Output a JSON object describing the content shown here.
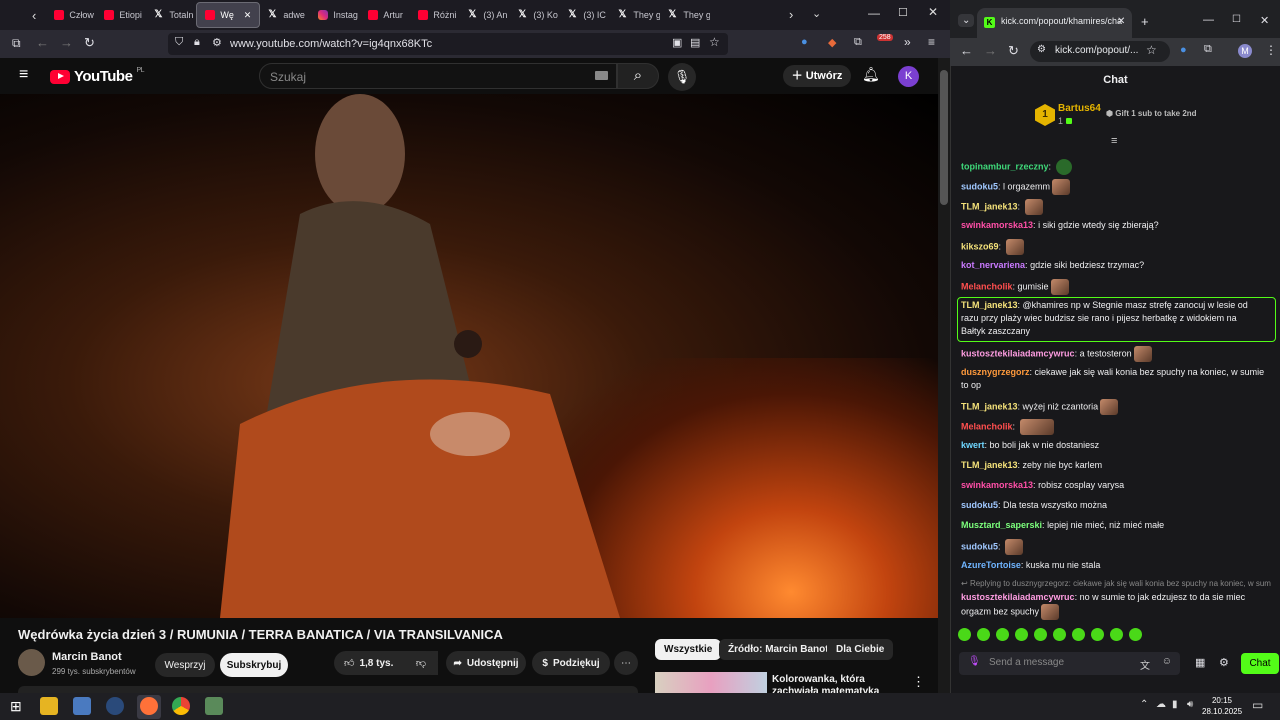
{
  "firefox": {
    "tabs": [
      {
        "label": "Człow",
        "icon": "youtube-icon"
      },
      {
        "label": "Etiopi",
        "icon": "youtube-icon"
      },
      {
        "label": "Totaln",
        "icon": "x-icon"
      },
      {
        "label": "Wę",
        "icon": "youtube-icon",
        "active": true
      },
      {
        "label": "adwe",
        "icon": "x-icon"
      },
      {
        "label": "Instag",
        "icon": "instagram-icon"
      },
      {
        "label": "Artur",
        "icon": "youtube-icon"
      },
      {
        "label": "Różni",
        "icon": "youtube-icon"
      },
      {
        "label": "(3) An",
        "icon": "x-icon"
      },
      {
        "label": "(3) Ko",
        "icon": "x-icon"
      },
      {
        "label": "(3) IC",
        "icon": "x-icon"
      },
      {
        "label": "They g",
        "icon": "x-icon"
      },
      {
        "label": "They g",
        "icon": "x-icon"
      }
    ],
    "url": "www.youtube.com/watch?v=ig4qnx68KTc",
    "ext_badge": "258"
  },
  "youtube": {
    "logo": "YouTube",
    "region": "PL",
    "search_placeholder": "Szukaj",
    "create_label": "Utwórz",
    "avatar_letter": "K",
    "video_title": "Wędrówka życia dzień 3 / RUMUNIA / TERRA BANATICA / VIA TRANSILVANICA",
    "channel_name": "Marcin Banot",
    "subscribers": "299 tys. subskrybentów",
    "support_label": "Wesprzyj",
    "subscribe_label": "Subskrybuj",
    "likes": "1,8 tys.",
    "share_label": "Udostępnij",
    "thanks_label": "Podziękuj",
    "chips": [
      "Wszystkie",
      "Źródło: Marcin Banot",
      "Dla Ciebie"
    ],
    "rec_title": "Kolorowanka, która zachwiała matematyką"
  },
  "chrome": {
    "tab_title": "kick.com/popout/khamires/cha",
    "url": "kick.com/popout/...",
    "profile": "M"
  },
  "kick": {
    "header": "Chat",
    "pinned": {
      "rank": "1",
      "user": "Bartus64",
      "count": "1",
      "gift_text": "Gift 1 sub to take 2nd"
    },
    "messages": [
      {
        "user": "topinambur_rzeczny",
        "color": "#3fd97a",
        "text": "",
        "emote": "green"
      },
      {
        "user": "sudoku5",
        "color": "#a0c8ff",
        "text": "l orgazemm",
        "emote": "face"
      },
      {
        "user": "TLM_janek13",
        "color": "#f5e27a",
        "text": "",
        "emote": "face"
      },
      {
        "user": "swinkamorska13",
        "color": "#ff4fa8",
        "text": "i siki gdzie wtedy się zbierają?"
      },
      {
        "user": "kikszo69",
        "color": "#f5e27a",
        "text": "",
        "emote": "face"
      },
      {
        "user": "kot_nervariena",
        "color": "#c97aff",
        "text": "gdzie siki bedziesz trzymac?"
      },
      {
        "user": "Melancholik",
        "color": "#ff4f4f",
        "text": "gumisie",
        "emote": "face"
      },
      {
        "user": "TLM_janek13",
        "color": "#f5e27a",
        "text": "@khamires np w Stegnie masz strefę zanocuj w lesie od razu przy plaży wiec budzisz sie rano i pijesz herbatkę z widokiem na Bałtyk zaszczany"
      },
      {
        "user": "kustosztekilaiadamcywruc",
        "color": "#ff9de2",
        "text": "a testosteron",
        "emote": "face"
      },
      {
        "user": "dusznygrzegorz",
        "color": "#ff9a3c",
        "text": "ciekawe jak się wali konia bez spuchy na koniec, w sumie to op"
      },
      {
        "user": "TLM_janek13",
        "color": "#f5e27a",
        "text": "wyżej niż czantoria",
        "emote": "face"
      },
      {
        "user": "Melancholik",
        "color": "#ff4f4f",
        "text": ""
      },
      {
        "user": "kwert",
        "color": "#6fd6ff",
        "text": "bo boli jak w nie dostaniesz"
      },
      {
        "user": "TLM_janek13",
        "color": "#f5e27a",
        "text": "zeby nie byc karlem"
      },
      {
        "user": "swinkamorska13",
        "color": "#ff4fa8",
        "text": "robisz cosplay varysa"
      },
      {
        "user": "sudoku5",
        "color": "#a0c8ff",
        "text": "Dla testa wszystko można"
      },
      {
        "user": "Musztard_saperski",
        "color": "#7cff7c",
        "text": "lepiej nie mieć, niż mieć małe"
      },
      {
        "user": "sudoku5",
        "color": "#a0c8ff",
        "text": "",
        "emote": "face"
      },
      {
        "user": "AzureTortoise",
        "color": "#6fb4ff",
        "text": "kuska mu nie stala"
      }
    ],
    "reply_preview": "Replying to dusznygrzegorz: ciekawe jak się wali konia bez spuchy na koniec, w sumie to op",
    "last_message": {
      "user": "kustosztekilaiadamcywruc",
      "color": "#ff9de2",
      "text": "no w sumie to jak edzujesz to da sie miec orgazm bez spuchy"
    },
    "input_placeholder": "Send a message",
    "send_label": "Chat"
  },
  "taskbar": {
    "time": "20:15",
    "date": "28.10.2025"
  }
}
